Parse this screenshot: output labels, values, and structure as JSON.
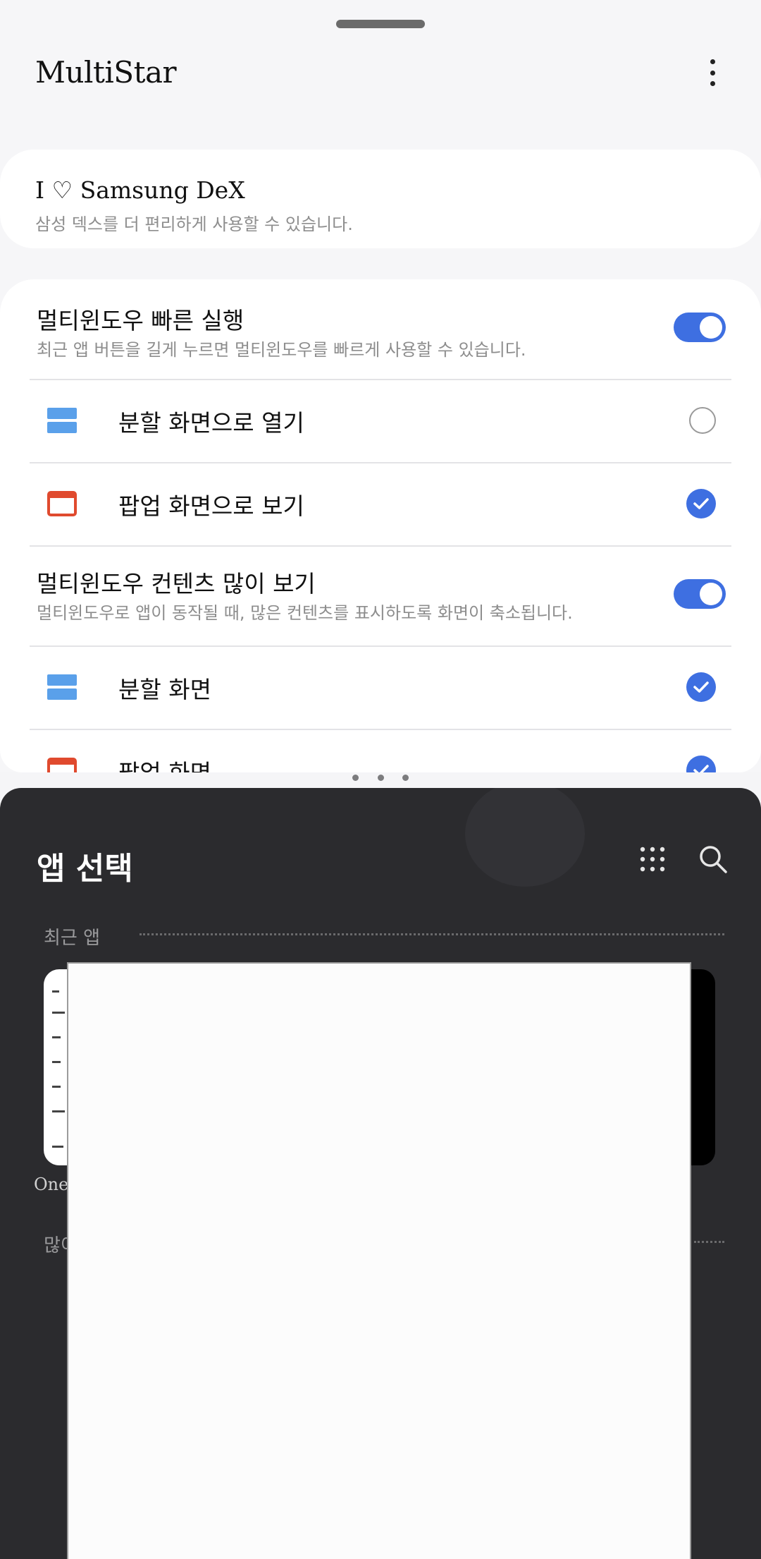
{
  "app": {
    "title": "MultiStar"
  },
  "dex_card": {
    "title": "I ♡ Samsung DeX",
    "subtitle": "삼성 덱스를 더 편리하게 사용할 수 있습니다."
  },
  "settings": {
    "quick_launch": {
      "title": "멀티윈도우 빠른 실행",
      "subtitle": "최근 앱 버튼을 길게 누르면 멀티윈도우를 빠르게 사용할 수 있습니다.",
      "enabled": true,
      "options": [
        {
          "label": "분할 화면으로 열기",
          "icon": "split-screen-icon",
          "selected": false
        },
        {
          "label": "팝업 화면으로 보기",
          "icon": "popup-window-icon",
          "selected": true
        }
      ]
    },
    "more_content": {
      "title": "멀티윈도우 컨텐츠 많이 보기",
      "subtitle": "멀티윈도우로 앱이 동작될 때, 많은 컨텐츠를 표시하도록 화면이 축소됩니다.",
      "enabled": true,
      "options": [
        {
          "label": "분할 화면",
          "icon": "split-screen-icon",
          "selected": true
        },
        {
          "label": "팝업 화면",
          "icon": "popup-window-icon",
          "selected": true
        }
      ]
    }
  },
  "app_picker": {
    "title": "앱 선택",
    "recent_label": "최근 앱",
    "recent_app_label": "One",
    "many_label": "많이"
  },
  "colors": {
    "accent": "#3e6fe1",
    "split_icon": "#5aa0ea",
    "popup_icon": "#e04a2e",
    "picker_bg": "#2b2b2e"
  }
}
